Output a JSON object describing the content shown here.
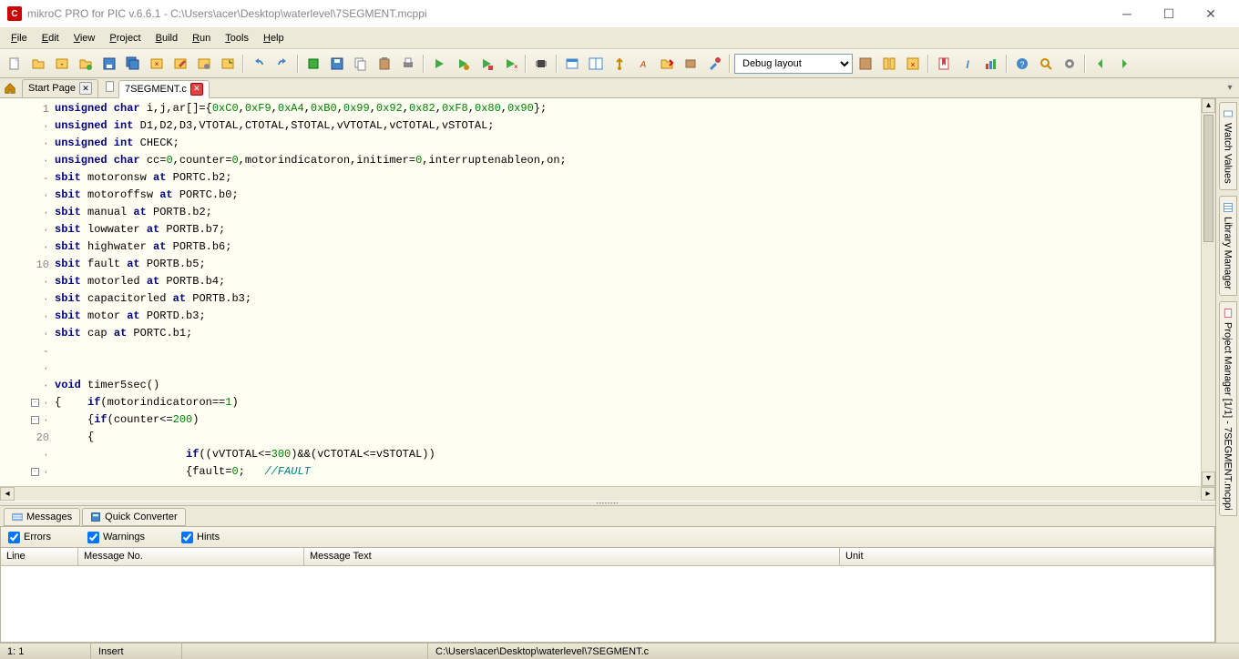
{
  "title": "mikroC PRO for PIC v.6.6.1 - C:\\Users\\acer\\Desktop\\waterlevel\\7SEGMENT.mcppi",
  "app_icon_letter": "C",
  "menus": [
    "File",
    "Edit",
    "View",
    "Project",
    "Build",
    "Run",
    "Tools",
    "Help"
  ],
  "layout_select": "Debug layout",
  "tabs": {
    "start_page": "Start Page",
    "file_tab": "7SEGMENT.c"
  },
  "gutter": [
    "1",
    "·",
    "·",
    "·",
    "-",
    "·",
    "·",
    "·",
    "·",
    "10",
    "·",
    "·",
    "·",
    "·",
    "-",
    "·",
    "·",
    "·",
    "·",
    "20",
    "·",
    "·"
  ],
  "code_lines": [
    {
      "t": "plain",
      "parts": [
        {
          "k": "kw",
          "v": "unsigned char"
        },
        {
          "k": "p",
          "v": " i,j,ar[]={"
        },
        {
          "k": "num",
          "v": "0xC0"
        },
        {
          "k": "p",
          "v": ","
        },
        {
          "k": "num",
          "v": "0xF9"
        },
        {
          "k": "p",
          "v": ","
        },
        {
          "k": "num",
          "v": "0xA4"
        },
        {
          "k": "p",
          "v": ","
        },
        {
          "k": "num",
          "v": "0xB0"
        },
        {
          "k": "p",
          "v": ","
        },
        {
          "k": "num",
          "v": "0x99"
        },
        {
          "k": "p",
          "v": ","
        },
        {
          "k": "num",
          "v": "0x92"
        },
        {
          "k": "p",
          "v": ","
        },
        {
          "k": "num",
          "v": "0x82"
        },
        {
          "k": "p",
          "v": ","
        },
        {
          "k": "num",
          "v": "0xF8"
        },
        {
          "k": "p",
          "v": ","
        },
        {
          "k": "num",
          "v": "0x80"
        },
        {
          "k": "p",
          "v": ","
        },
        {
          "k": "num",
          "v": "0x90"
        },
        {
          "k": "p",
          "v": "};"
        }
      ]
    },
    {
      "t": "plain",
      "parts": [
        {
          "k": "kw",
          "v": "unsigned int"
        },
        {
          "k": "p",
          "v": " D1,D2,D3,VTOTAL,CTOTAL,STOTAL,vVTOTAL,vCTOTAL,vSTOTAL;"
        }
      ]
    },
    {
      "t": "plain",
      "parts": [
        {
          "k": "kw",
          "v": "unsigned int"
        },
        {
          "k": "p",
          "v": " CHECK;"
        }
      ]
    },
    {
      "t": "plain",
      "parts": [
        {
          "k": "kw",
          "v": "unsigned char"
        },
        {
          "k": "p",
          "v": " cc="
        },
        {
          "k": "num",
          "v": "0"
        },
        {
          "k": "p",
          "v": ",counter="
        },
        {
          "k": "num",
          "v": "0"
        },
        {
          "k": "p",
          "v": ",motorindicatoron,initimer="
        },
        {
          "k": "num",
          "v": "0"
        },
        {
          "k": "p",
          "v": ",interruptenableon,on;"
        }
      ]
    },
    {
      "t": "plain",
      "parts": [
        {
          "k": "kw",
          "v": "sbit"
        },
        {
          "k": "p",
          "v": " motoronsw "
        },
        {
          "k": "kw",
          "v": "at"
        },
        {
          "k": "p",
          "v": " PORTC.b2;"
        }
      ]
    },
    {
      "t": "plain",
      "parts": [
        {
          "k": "kw",
          "v": "sbit"
        },
        {
          "k": "p",
          "v": " motoroffsw "
        },
        {
          "k": "kw",
          "v": "at"
        },
        {
          "k": "p",
          "v": " PORTC.b0;"
        }
      ]
    },
    {
      "t": "plain",
      "parts": [
        {
          "k": "kw",
          "v": "sbit"
        },
        {
          "k": "p",
          "v": " manual "
        },
        {
          "k": "kw",
          "v": "at"
        },
        {
          "k": "p",
          "v": " PORTB.b2;"
        }
      ]
    },
    {
      "t": "plain",
      "parts": [
        {
          "k": "kw",
          "v": "sbit"
        },
        {
          "k": "p",
          "v": " lowwater "
        },
        {
          "k": "kw",
          "v": "at"
        },
        {
          "k": "p",
          "v": " PORTB.b7;"
        }
      ]
    },
    {
      "t": "plain",
      "parts": [
        {
          "k": "kw",
          "v": "sbit"
        },
        {
          "k": "p",
          "v": " highwater "
        },
        {
          "k": "kw",
          "v": "at"
        },
        {
          "k": "p",
          "v": " PORTB.b6;"
        }
      ]
    },
    {
      "t": "plain",
      "parts": [
        {
          "k": "kw",
          "v": "sbit"
        },
        {
          "k": "p",
          "v": " fault "
        },
        {
          "k": "kw",
          "v": "at"
        },
        {
          "k": "p",
          "v": " PORTB.b5;"
        }
      ]
    },
    {
      "t": "plain",
      "parts": [
        {
          "k": "kw",
          "v": "sbit"
        },
        {
          "k": "p",
          "v": " motorled "
        },
        {
          "k": "kw",
          "v": "at"
        },
        {
          "k": "p",
          "v": " PORTB.b4;"
        }
      ]
    },
    {
      "t": "plain",
      "parts": [
        {
          "k": "kw",
          "v": "sbit"
        },
        {
          "k": "p",
          "v": " capacitorled "
        },
        {
          "k": "kw",
          "v": "at"
        },
        {
          "k": "p",
          "v": " PORTB.b3;"
        }
      ]
    },
    {
      "t": "plain",
      "parts": [
        {
          "k": "kw",
          "v": "sbit"
        },
        {
          "k": "p",
          "v": " motor "
        },
        {
          "k": "kw",
          "v": "at"
        },
        {
          "k": "p",
          "v": " PORTD.b3;"
        }
      ]
    },
    {
      "t": "plain",
      "parts": [
        {
          "k": "kw",
          "v": "sbit"
        },
        {
          "k": "p",
          "v": " cap "
        },
        {
          "k": "kw",
          "v": "at"
        },
        {
          "k": "p",
          "v": " PORTC.b1;"
        }
      ]
    },
    {
      "t": "plain",
      "parts": []
    },
    {
      "t": "plain",
      "parts": []
    },
    {
      "t": "plain",
      "parts": [
        {
          "k": "kw",
          "v": "void"
        },
        {
          "k": "p",
          "v": " timer5sec()"
        }
      ]
    },
    {
      "t": "fold",
      "parts": [
        {
          "k": "p",
          "v": "{    "
        },
        {
          "k": "kw",
          "v": "if"
        },
        {
          "k": "p",
          "v": "(motorindicatoron=="
        },
        {
          "k": "num",
          "v": "1"
        },
        {
          "k": "p",
          "v": ")"
        }
      ]
    },
    {
      "t": "fold",
      "parts": [
        {
          "k": "p",
          "v": "     {"
        },
        {
          "k": "kw",
          "v": "if"
        },
        {
          "k": "p",
          "v": "(counter<="
        },
        {
          "k": "num",
          "v": "200"
        },
        {
          "k": "p",
          "v": ")"
        }
      ]
    },
    {
      "t": "plain",
      "parts": [
        {
          "k": "p",
          "v": "     {"
        }
      ]
    },
    {
      "t": "plain",
      "parts": [
        {
          "k": "p",
          "v": "                    "
        },
        {
          "k": "kw",
          "v": "if"
        },
        {
          "k": "p",
          "v": "((vVTOTAL<="
        },
        {
          "k": "num",
          "v": "300"
        },
        {
          "k": "p",
          "v": ")&&(vCTOTAL<=vSTOTAL))"
        }
      ]
    },
    {
      "t": "fold",
      "parts": [
        {
          "k": "p",
          "v": "                    {fault="
        },
        {
          "k": "num",
          "v": "0"
        },
        {
          "k": "p",
          "v": ";   "
        },
        {
          "k": "cmt",
          "v": "//FAULT"
        }
      ]
    }
  ],
  "messages_panel": {
    "tab_messages": "Messages",
    "tab_quick": "Quick Converter",
    "filter_errors": "Errors",
    "filter_warnings": "Warnings",
    "filter_hints": "Hints",
    "col_line": "Line",
    "col_msgno": "Message No.",
    "col_msgtext": "Message Text",
    "col_unit": "Unit"
  },
  "side": {
    "watch": "Watch Values",
    "library": "Library Manager",
    "project": "Project Manager [1/1] - 7SEGMENT.mcppi"
  },
  "status": {
    "pos": "1: 1",
    "mode": "Insert",
    "path": "C:\\Users\\acer\\Desktop\\waterlevel\\7SEGMENT.c"
  }
}
